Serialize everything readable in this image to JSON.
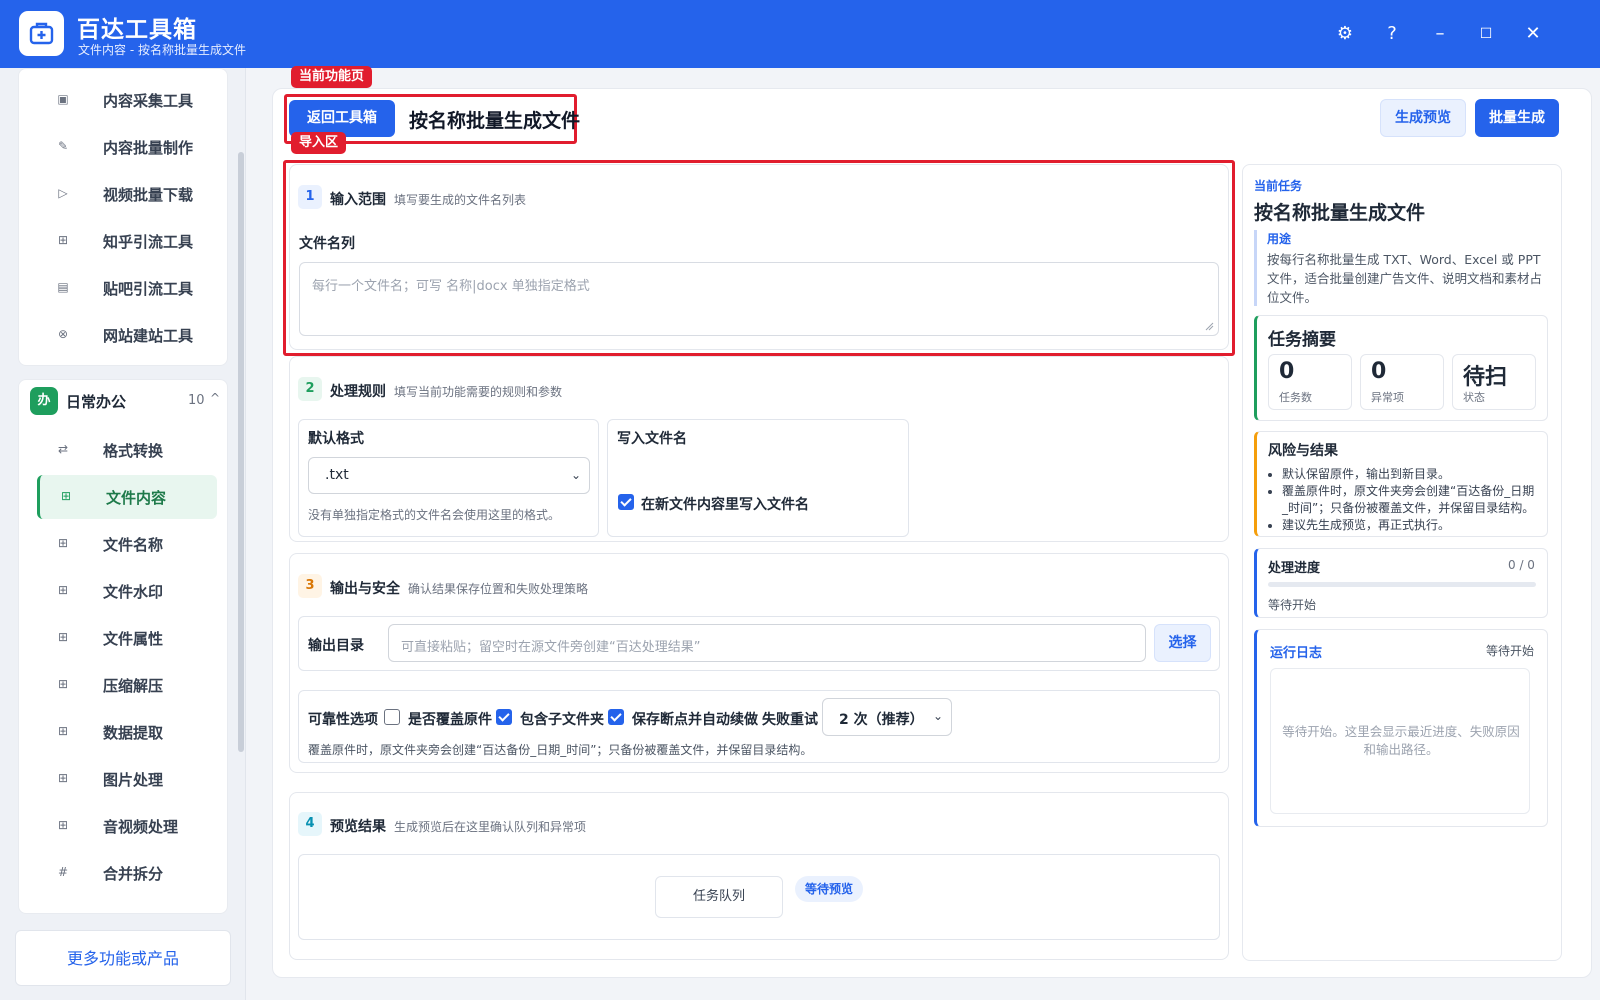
{
  "app": {
    "title": "百达工具箱",
    "subtitle": "文件内容 - 按名称批量生成文件",
    "controls": {
      "settings": "⚙",
      "help": "?",
      "minimize": "–",
      "maximize": "☐",
      "close": "✕"
    }
  },
  "sidebar": {
    "top_items": [
      {
        "label": "内容采集工具",
        "icon": "▣"
      },
      {
        "label": "内容批量制作",
        "icon": "✎"
      },
      {
        "label": "视频批量下载",
        "icon": "▷"
      },
      {
        "label": "知乎引流工具",
        "icon": "⊞"
      },
      {
        "label": "贴吧引流工具",
        "icon": "▤"
      },
      {
        "label": "网站建站工具",
        "icon": "⊗"
      }
    ],
    "group": {
      "badge": "办",
      "title": "日常办公",
      "count": "10",
      "caret": "^"
    },
    "group_items": [
      {
        "label": "格式转换",
        "icon": "⇄"
      },
      {
        "label": "文件内容",
        "icon": "⊞"
      },
      {
        "label": "文件名称",
        "icon": "⊞"
      },
      {
        "label": "文件水印",
        "icon": "⊞"
      },
      {
        "label": "文件属性",
        "icon": "⊞"
      },
      {
        "label": "压缩解压",
        "icon": "⊞"
      },
      {
        "label": "数据提取",
        "icon": "⊞"
      },
      {
        "label": "图片处理",
        "icon": "⊞"
      },
      {
        "label": "音视频处理",
        "icon": "⊞"
      },
      {
        "label": "合并拆分",
        "icon": "#"
      }
    ],
    "active_item": "文件内容",
    "more_label": "更多功能或产品"
  },
  "header": {
    "current_tag": "当前功能页",
    "back_label": "返回工具箱",
    "title": "按名称批量生成文件",
    "preview_label": "生成预览",
    "batch_label": "批量生成",
    "import_tag": "导入区"
  },
  "section1": {
    "num": "1",
    "title": "输入范围",
    "desc": "填写要生成的文件名列表",
    "field_label": "文件名列",
    "placeholder": "每行一个文件名；可写 名称|docx 单独指定格式"
  },
  "section2": {
    "num": "2",
    "title": "处理规则",
    "desc": "填写当前功能需要的规则和参数",
    "format_label": "默认格式",
    "format_value": ".txt",
    "format_hint": "没有单独指定格式的文件名会使用这里的格式。",
    "write_label": "写入文件名",
    "write_option": "在新文件内容里写入文件名",
    "write_checked": true
  },
  "section3": {
    "num": "3",
    "title": "输出与安全",
    "desc": "确认结果保存位置和失败处理策略",
    "output_label": "输出目录",
    "output_placeholder": "可直接粘贴；留空时在源文件旁创建“百达处理结果”",
    "choose_label": "选择",
    "reliability_label": "可靠性选项",
    "opt_overwrite": "是否覆盖原件",
    "opt_overwrite_checked": false,
    "opt_subfolder": "包含子文件夹",
    "opt_subfolder_checked": true,
    "opt_resume": "保存断点并自动续做",
    "opt_resume_checked": true,
    "retry_label": "失败重试",
    "retry_value": "2 次（推荐）",
    "hint": "覆盖原件时，原文件夹旁会创建“百达备份_日期_时间”；只备份被覆盖文件，并保留目录结构。"
  },
  "section4": {
    "num": "4",
    "title": "预览结果",
    "desc": "生成预览后在这里确认队列和异常项",
    "queue_label": "任务队列",
    "status_badge": "等待预览"
  },
  "right": {
    "current_label": "当前任务",
    "current_title": "按名称批量生成文件",
    "purpose_label": "用途",
    "purpose_text": "按每行名称批量生成 TXT、Word、Excel 或 PPT 文件，适合批量创建广告文件、说明文档和素材占位文件。",
    "summary_title": "任务摘要",
    "stats": [
      {
        "value": "0",
        "label": "任务数"
      },
      {
        "value": "0",
        "label": "异常项"
      },
      {
        "value": "待扫",
        "label": "状态"
      }
    ],
    "risk_title": "风险与结果",
    "risks": [
      "默认保留原件，输出到新目录。",
      "覆盖原件时，原文件夹旁会创建“百达备份_日期_时间”；只备份被覆盖文件，并保留目录结构。",
      "建议先生成预览，再正式执行。"
    ],
    "progress_title": "处理进度",
    "progress_count": "0 / 0",
    "progress_value": 0,
    "progress_status": "等待开始",
    "log_title": "运行日志",
    "log_status": "等待开始",
    "log_empty": "等待开始。这里会显示最近进度、失败原因和输出路径。"
  },
  "colors": {
    "brand": "#2563eb",
    "accent_green": "#1e9e5d",
    "highlight_red": "#e11d2e",
    "risk_orange": "#f59e0b"
  }
}
